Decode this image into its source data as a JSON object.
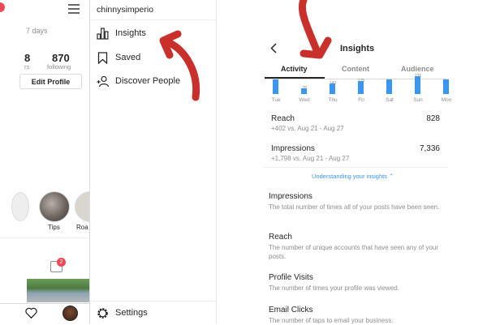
{
  "profile": {
    "days_text": "7 days",
    "stats": [
      {
        "value": "8",
        "label": "rs"
      },
      {
        "value": "870",
        "label": "following"
      }
    ],
    "edit_profile_label": "Edit Profile",
    "highlights": [
      {
        "label": ""
      },
      {
        "label": "Tips"
      },
      {
        "label": "Roa"
      }
    ],
    "notification_count": "2"
  },
  "menu": {
    "username": "chinnysimperio",
    "items": [
      {
        "label": "Insights",
        "icon": "bar-chart-icon"
      },
      {
        "label": "Saved",
        "icon": "bookmark-icon"
      },
      {
        "label": "Discover People",
        "icon": "add-person-icon"
      }
    ],
    "settings_label": "Settings"
  },
  "insights": {
    "title": "Insights",
    "tabs": [
      {
        "label": "Activity",
        "active": true
      },
      {
        "label": "Content",
        "active": false
      },
      {
        "label": "Audience",
        "active": false
      }
    ],
    "chart_data": {
      "type": "bar",
      "categories": [
        "Tue",
        "Wed",
        "Thu",
        "Fri",
        "Sat",
        "Sun",
        "Mon"
      ],
      "values": [
        200,
        78,
        140,
        175,
        200,
        235,
        200
      ],
      "labels": [
        "",
        "78",
        "140",
        "175",
        "",
        "235",
        ""
      ],
      "ylim": [
        0,
        240
      ]
    },
    "metrics": [
      {
        "name": "Reach",
        "value": "828",
        "delta": "+402 vs. Aug 21 - Aug 27"
      },
      {
        "name": "Impressions",
        "value": "7,336",
        "delta": "+1,798 vs. Aug 21 - Aug 27"
      }
    ],
    "understanding_link": "Understanding your insights",
    "definitions": [
      {
        "title": "Impressions",
        "desc": "The total number of times all of your posts have been seen."
      },
      {
        "title": "Reach",
        "desc": "The number of unique accounts that have seen any of your posts."
      },
      {
        "title": "Profile Visits",
        "desc": "The number of times your profile was viewed."
      },
      {
        "title": "Email Clicks",
        "desc": "The number of taps to email your business."
      }
    ]
  },
  "colors": {
    "accent": "#3897f0",
    "arrow": "#c9302c",
    "notification": "#ed4956"
  }
}
